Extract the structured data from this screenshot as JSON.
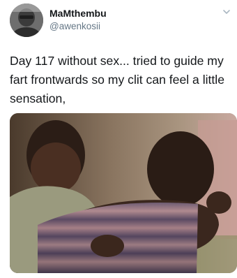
{
  "author": {
    "display_name": "MaMthembu",
    "handle": "@awenkosii",
    "avatar_icon": "profile-photo"
  },
  "tweet": {
    "text": "Day 117 without sex... tried to guide my\nfart frontwards so my clit can feel a little\nsensation,"
  },
  "menu": {
    "icon": "chevron-down-icon"
  },
  "media": {
    "type": "photo"
  },
  "colors": {
    "text": "#14171a",
    "secondary": "#657786",
    "background": "#ffffff"
  }
}
